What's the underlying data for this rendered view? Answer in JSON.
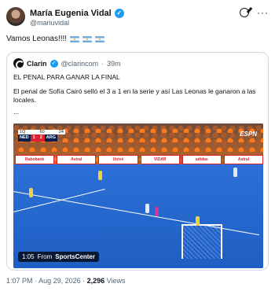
{
  "author": {
    "name": "María Eugenia Vidal",
    "handle": "@mariuvidal",
    "verified_icon": "verified-badge-icon"
  },
  "header_icons": [
    "grok-icon",
    "more-icon"
  ],
  "tweet": {
    "text": "Vamos Leonas!!!!",
    "flags": [
      "argentina-flag",
      "argentina-flag",
      "argentina-flag"
    ]
  },
  "quoted": {
    "name": "Clarín",
    "handle": "@clarincom",
    "separator": "·",
    "time": "39m",
    "headline": "EL PENAL PARA GANAR LA FINAL",
    "body": "El penal de Sofía Cairó selló el 3 a 1 en la serie y así Las Leonas le ganaron a las locales.",
    "ellipsis": "...",
    "video": {
      "score_bug": {
        "top_left": "1Q",
        "top_mid": "60",
        "top_right": "24",
        "team_home": "NED",
        "score_home": "1",
        "score_away": "2",
        "team_away": "ARG"
      },
      "network": "ESPN",
      "boards": [
        "Rabobank",
        "Astral",
        "Univé",
        "VIDAR",
        "adidas",
        "Astral"
      ],
      "duration": "1:05",
      "from_label": "From",
      "source": "SportsCenter"
    }
  },
  "footer": {
    "time": "1:07 PM",
    "sep1": "·",
    "date": "Aug 29, 2026",
    "sep2": "·",
    "views_count": "2,296",
    "views_label": "Views"
  },
  "colors": {
    "accent": "#1d9bf0",
    "text": "#0f1419",
    "muted": "#536471",
    "pitch": "#1f5fc4",
    "crowd_orange": "#ff7a1a"
  }
}
